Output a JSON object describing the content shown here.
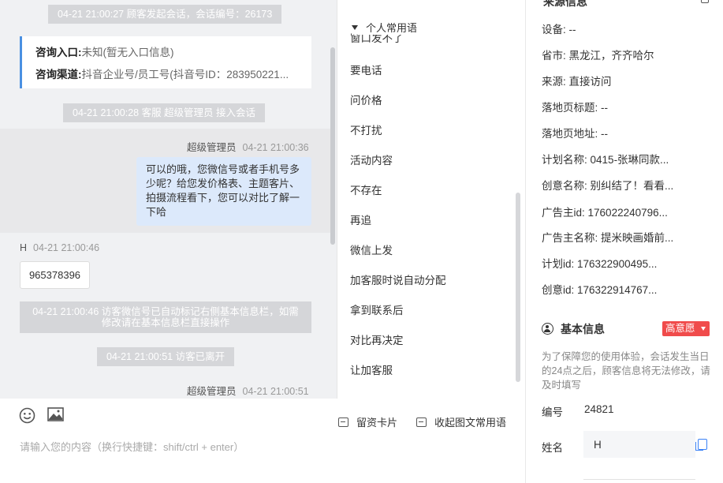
{
  "chat": {
    "sys1": "04-21 21:00:27 顾客发起会话，会话编号：26173",
    "entry_label": "咨询入口:",
    "entry_value": "未知(暂无入口信息)",
    "channel_label": "咨询渠道:",
    "channel_value": "抖音企业号/员工号(抖音号ID：283950221...",
    "sys2": "04-21 21:00:28 客服 超级管理员 接入会话",
    "agent_name": "超级管理员",
    "agent_time1": "04-21 21:00:36",
    "agent_message": "可以的哦，您微信号或者手机号多少呢？给您发价格表、主题客片、拍摄流程看下，您可以对比了解一下哈",
    "customer_name": "H",
    "customer_time": "04-21 21:00:46",
    "customer_message": "965378396",
    "sys3": "04-21 21:00:46 访客微信号已自动标记右侧基本信息栏，如需修改请在基本信息栏直接操作",
    "sys4": "04-21 21:00:51 访客已离开",
    "agent_time2": "04-21 21:00:51"
  },
  "toolbar": {
    "emoji_icon": "smiley-icon",
    "image_icon": "image-icon",
    "card_label": "留资卡片",
    "collect_label": "收起图文常用语",
    "input_placeholder": "请输入您的内容（换行快捷键：shift/ctrl + enter）"
  },
  "phrases": {
    "header": "个人常用语",
    "cut_item": "窗口发不了",
    "items": [
      "要电话",
      "问价格",
      "不打扰",
      "活动内容",
      "不存在",
      "再追",
      "微信上发",
      "加客服时说自动分配",
      "拿到联系后",
      "对比再决定",
      "让加客服"
    ]
  },
  "info": {
    "top_title": "来源信息",
    "rows": [
      {
        "label": "设备:",
        "value": "--"
      },
      {
        "label": "省市:",
        "value": "黑龙江，齐齐哈尔"
      },
      {
        "label": "来源:",
        "value": "直接访问"
      },
      {
        "label": "落地页标题:",
        "value": "--"
      },
      {
        "label": "落地页地址:",
        "value": "--"
      },
      {
        "label": "计划名称:",
        "value": "0415-张琳同款..."
      },
      {
        "label": "创意名称:",
        "value": "别纠结了！看看..."
      },
      {
        "label": "广告主id:",
        "value": "176022240796..."
      },
      {
        "label": "广告主名称:",
        "value": "提米映画婚前..."
      },
      {
        "label": "计划id:",
        "value": "176322900495..."
      },
      {
        "label": "创意id:",
        "value": "176322914767..."
      }
    ],
    "section_title": "基本信息",
    "intent_badge": "高意愿",
    "note": "为了保障您的使用体验，会话发生当日的24点之后，顾客信息将无法修改，请及时填写",
    "id_label": "编号",
    "id_value": "24821",
    "name_label": "姓名",
    "name_value": "H"
  }
}
